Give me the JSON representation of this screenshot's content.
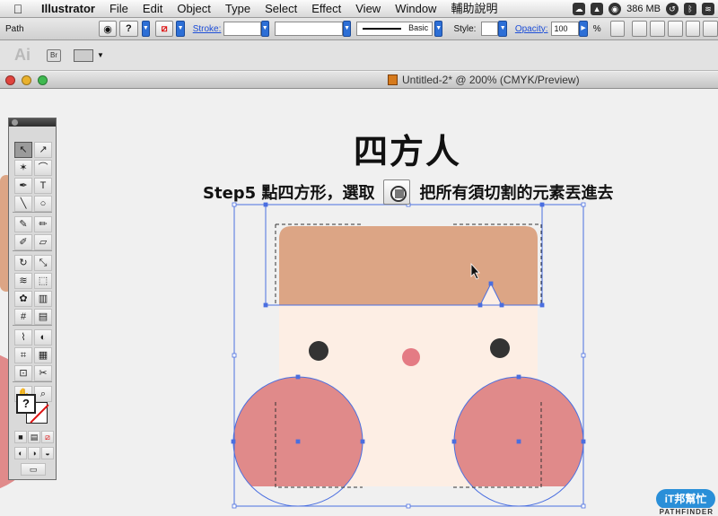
{
  "menubar": {
    "app_name": "Illustrator",
    "items": [
      "File",
      "Edit",
      "Object",
      "Type",
      "Select",
      "Effect",
      "View",
      "Window",
      "輔助說明"
    ],
    "memory": "386 MB"
  },
  "controlbar": {
    "selection_type": "Path",
    "stroke_label": "Stroke:",
    "brush_name": "Basic",
    "style_label": "Style:",
    "opacity_label": "Opacity:",
    "opacity_value": "100",
    "opacity_unit": "%"
  },
  "appbar": {
    "logo": "Ai",
    "bridge_button": "Br"
  },
  "document": {
    "title": "Untitled-2* @ 200% (CMYK/Preview)"
  },
  "tools": {
    "items": [
      {
        "name": "selection-tool",
        "glyph": "↖"
      },
      {
        "name": "direct-selection-tool",
        "glyph": "↗"
      },
      {
        "name": "magic-wand-tool",
        "glyph": "✶"
      },
      {
        "name": "lasso-tool",
        "glyph": "⌒"
      },
      {
        "name": "pen-tool",
        "glyph": "✒"
      },
      {
        "name": "type-tool",
        "glyph": "T"
      },
      {
        "name": "line-tool",
        "glyph": "╲"
      },
      {
        "name": "ellipse-tool",
        "glyph": "○"
      },
      {
        "name": "brush-tool",
        "glyph": "✎"
      },
      {
        "name": "pencil-tool",
        "glyph": "✏"
      },
      {
        "name": "blob-brush-tool",
        "glyph": "✐"
      },
      {
        "name": "eraser-tool",
        "glyph": "▱"
      },
      {
        "name": "rotate-tool",
        "glyph": "↻"
      },
      {
        "name": "scale-tool",
        "glyph": "⤡"
      },
      {
        "name": "warp-tool",
        "glyph": "≋"
      },
      {
        "name": "free-transform-tool",
        "glyph": "⬚"
      },
      {
        "name": "symbol-sprayer-tool",
        "glyph": "✿"
      },
      {
        "name": "column-graph-tool",
        "glyph": "▥"
      },
      {
        "name": "mesh-tool",
        "glyph": "#"
      },
      {
        "name": "gradient-tool",
        "glyph": "▤"
      },
      {
        "name": "eyedropper-tool",
        "glyph": "⌇"
      },
      {
        "name": "blend-tool",
        "glyph": "◐"
      },
      {
        "name": "slice-tool",
        "glyph": "⌗"
      },
      {
        "name": "artboard-tool",
        "glyph": "▦"
      },
      {
        "name": "crop-tool",
        "glyph": "⊡"
      },
      {
        "name": "scissors-tool",
        "glyph": "✂"
      },
      {
        "name": "hand-tool",
        "glyph": "✋"
      },
      {
        "name": "zoom-tool",
        "glyph": "⌕"
      }
    ],
    "fill_glyph": "?"
  },
  "artwork": {
    "heading": "四方人",
    "step_label": "Step5 點四方形，選取",
    "step_suffix": "把所有須切割的元素丟進去",
    "colors": {
      "hair": "#dca585",
      "face": "#fdeee4",
      "cheek": "#e08a8a",
      "nose": "#e47b84",
      "eye": "#333333",
      "selection": "#4a6fe0"
    }
  },
  "watermark": {
    "badge": "iT邦幫忙",
    "subtitle": "PATHFINDER"
  }
}
